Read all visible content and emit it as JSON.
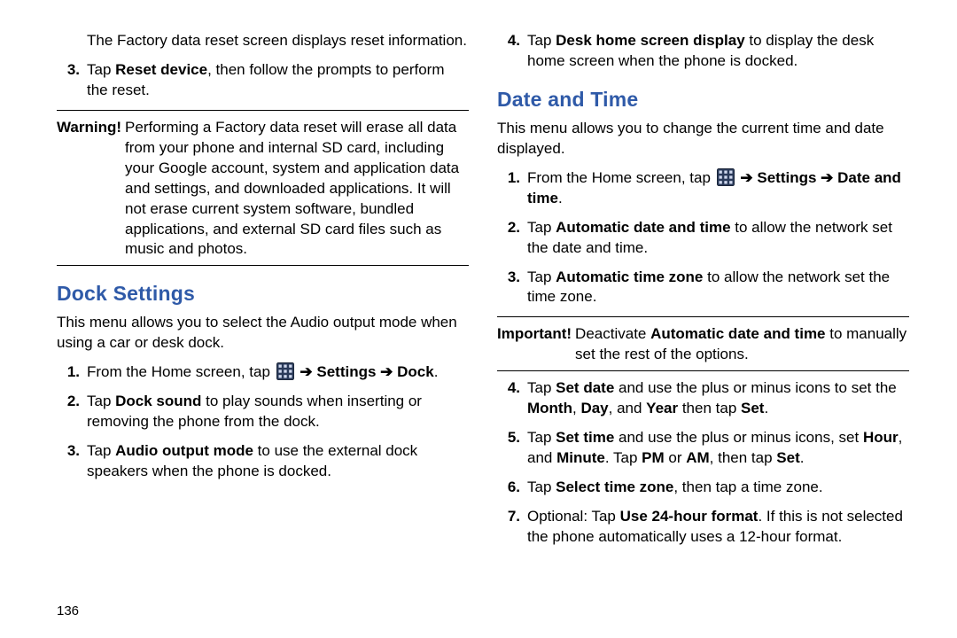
{
  "page_number": "136",
  "arrow_glyph": "➔",
  "icons": {
    "apps": "apps-grid-icon"
  },
  "left": {
    "intro": "The Factory data reset screen displays reset information.",
    "step3_num": "3.",
    "step3_pre": "Tap ",
    "step3_bold": "Reset device",
    "step3_post": ", then follow the prompts to perform the reset.",
    "warn_label": "Warning!",
    "warn_body": "Performing a Factory data reset will erase all data from your phone and internal SD card, including your Google account, system and application data and settings, and downloaded applications. It will not erase current system software, bundled applications, and external SD card files such as music and photos.",
    "heading": "Dock Settings",
    "dock_intro": "This menu allows you to select the Audio output mode when using a car or desk dock.",
    "dock1_num": "1.",
    "dock1_pre": "From the Home screen, tap ",
    "dock1_path_a": "Settings",
    "dock1_path_b": "Dock",
    "dock1_end": ".",
    "dock2_num": "2.",
    "dock2_pre": "Tap ",
    "dock2_bold": "Dock sound",
    "dock2_post": " to play sounds when inserting or removing the phone from the dock.",
    "dock3_num": "3.",
    "dock3_pre": "Tap ",
    "dock3_bold": "Audio output mode",
    "dock3_post": " to use the external dock speakers when the phone is docked."
  },
  "right": {
    "step4_num": "4.",
    "step4_pre": "Tap ",
    "step4_bold": "Desk home screen display",
    "step4_post": " to display the desk home screen when the phone is docked.",
    "heading": "Date and Time",
    "dt_intro": "This menu allows you to change the current time and date displayed.",
    "dt1_num": "1.",
    "dt1_pre": "From the Home screen, tap ",
    "dt1_path_a": "Settings",
    "dt1_path_b": "Date and time",
    "dt1_end": ".",
    "dt2_num": "2.",
    "dt2_pre": "Tap ",
    "dt2_bold": "Automatic date and time",
    "dt2_post": " to allow the network set the date and time.",
    "dt3_num": "3.",
    "dt3_pre": "Tap ",
    "dt3_bold": "Automatic time zone",
    "dt3_post": " to allow the network set the time zone.",
    "imp_label": "Important!",
    "imp_pre": " Deactivate ",
    "imp_bold": "Automatic date and time",
    "imp_post": " to manually set the rest of the options.",
    "dt4_num": "4.",
    "dt4_pre": "Tap ",
    "dt4_bold1": "Set date",
    "dt4_mid1": " and use the plus or minus icons to set the ",
    "dt4_bold2": "Month",
    "dt4_mid2": ", ",
    "dt4_bold3": "Day",
    "dt4_mid3": ", and ",
    "dt4_bold4": "Year",
    "dt4_mid4": " then tap ",
    "dt4_bold5": "Set",
    "dt4_end": ".",
    "dt5_num": "5.",
    "dt5_pre": "Tap ",
    "dt5_bold1": "Set time",
    "dt5_mid1": " and use the plus or minus icons, set ",
    "dt5_bold2": "Hour",
    "dt5_mid2": ", and ",
    "dt5_bold3": "Minute",
    "dt5_mid3": ". Tap ",
    "dt5_bold4": "PM",
    "dt5_mid4": " or ",
    "dt5_bold5": "AM",
    "dt5_mid5": ", then tap ",
    "dt5_bold6": "Set",
    "dt5_end": ".",
    "dt6_num": "6.",
    "dt6_pre": "Tap ",
    "dt6_bold": "Select time zone",
    "dt6_post": ", then tap a time zone.",
    "dt7_num": "7.",
    "dt7_pre": "Optional: Tap ",
    "dt7_bold": "Use 24-hour format",
    "dt7_post": ". If this is not selected the phone automatically uses a 12-hour format."
  }
}
